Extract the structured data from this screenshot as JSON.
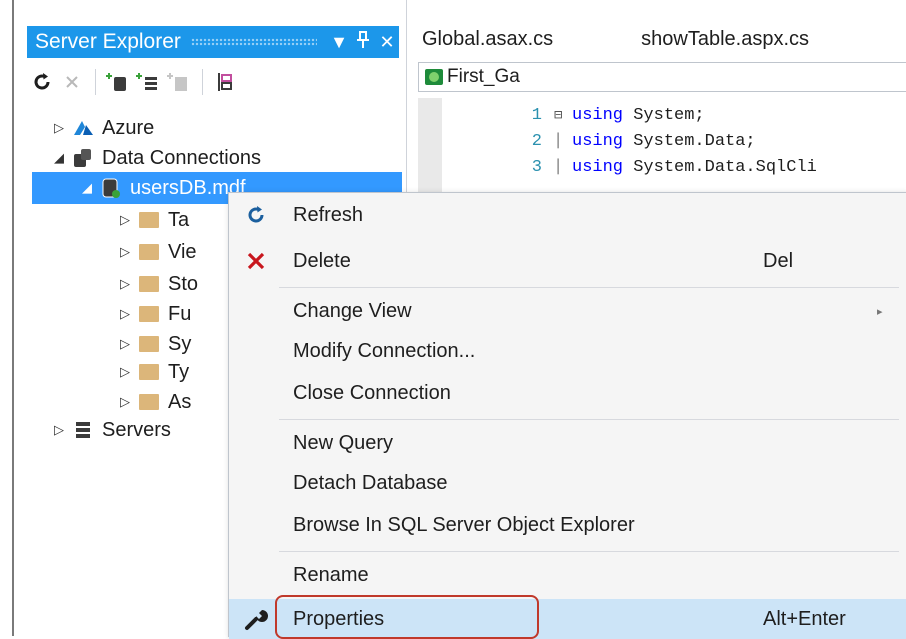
{
  "server_explorer": {
    "title": "Server Explorer",
    "header_buttons": [
      "▼",
      "⊓",
      "✕"
    ],
    "tree": {
      "azure": "Azure",
      "data_connections": "Data Connections",
      "db": "usersDB.mdf",
      "children": [
        "Ta",
        "Vie",
        "Sto",
        "Fu",
        "Sy",
        "Ty",
        "As"
      ],
      "servers": "Servers"
    }
  },
  "editor": {
    "tabs": [
      "Global.asax.cs",
      "showTable.aspx.cs"
    ],
    "file_label": "First_Ga",
    "lines": [
      {
        "num": "1",
        "kw": "using",
        "rest": " System;"
      },
      {
        "num": "2",
        "kw": "using",
        "rest": " System.Data;"
      },
      {
        "num": "3",
        "kw": "using",
        "rest": " System.Data.SqlCli"
      }
    ]
  },
  "context_menu": {
    "refresh": "Refresh",
    "delete": "Delete",
    "delete_key": "Del",
    "change_view": "Change View",
    "modify_connection": "Modify Connection...",
    "close_connection": "Close Connection",
    "new_query": "New Query",
    "detach_database": "Detach Database",
    "browse_sql": "Browse In SQL Server Object Explorer",
    "rename": "Rename",
    "properties": "Properties",
    "properties_key": "Alt+Enter"
  },
  "colors": {
    "accent": "#1c97ea",
    "selection": "#3399ff",
    "highlight_box": "#c0392b",
    "folder": "#dcb67a"
  }
}
